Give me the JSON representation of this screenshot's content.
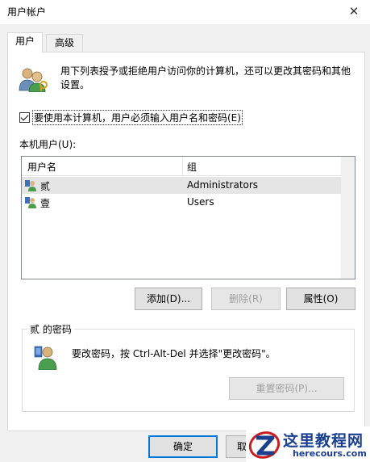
{
  "window": {
    "title": "用户帐户",
    "close_symbol": "✕"
  },
  "tabs": [
    {
      "label": "用户"
    },
    {
      "label": "高级"
    }
  ],
  "intro": "用下列表授予或拒绝用户访问你的计算机，还可以更改其密码和其他设置。",
  "require_login": {
    "label": "要使用本计算机，用户必须输入用户名和密码(E)",
    "checked": true
  },
  "users_list": {
    "label": "本机用户(U):",
    "columns": {
      "name": "用户名",
      "group": "组"
    },
    "rows": [
      {
        "name": "贰",
        "group": "Administrators",
        "selected": true
      },
      {
        "name": "壹",
        "group": "Users",
        "selected": false
      }
    ]
  },
  "buttons": {
    "add": "添加(D)...",
    "remove": "删除(R)",
    "properties": "属性(O)",
    "reset_password": "重置密码(P)...",
    "ok": "确定",
    "cancel": "取"
  },
  "password_group": {
    "title": "贰 的密码",
    "text": "要改密码，按 Ctrl-Alt-Del 并选择\"更改密码\"。"
  },
  "watermark": {
    "cn": "这里教程网",
    "en": "herecours.com"
  },
  "colors": {
    "ok_border": "#0078d7",
    "selection": "#e5e5e5",
    "watermark": "#1a3f8f"
  }
}
